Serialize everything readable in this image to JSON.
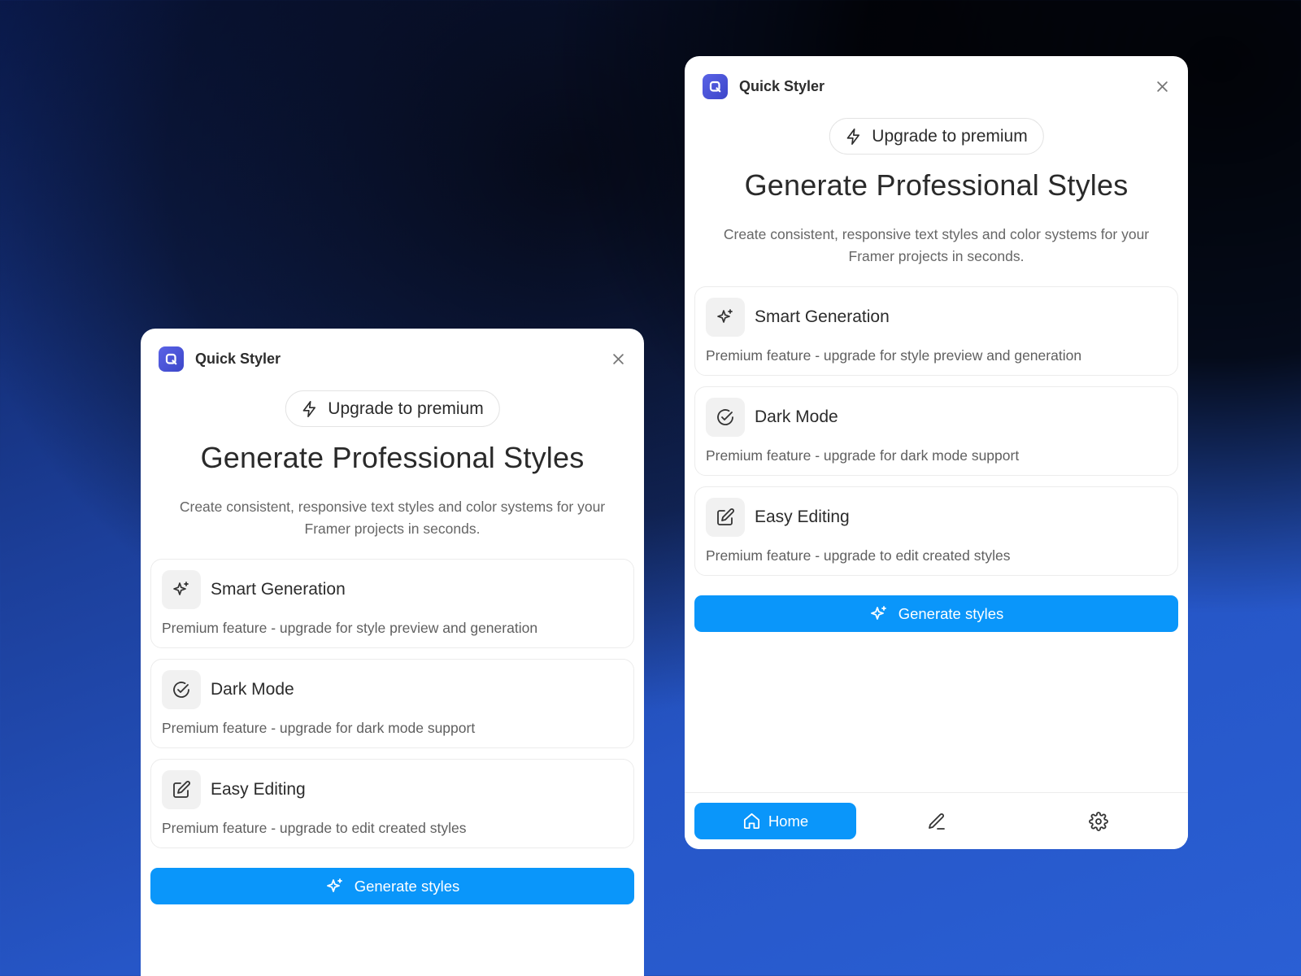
{
  "panels": [
    {
      "app_title": "Quick Styler",
      "upgrade_label": "Upgrade to premium",
      "headline": "Generate Professional Styles",
      "subhead_line1": "Create consistent, responsive text styles and color systems for your",
      "subhead_line2": "Framer projects in seconds.",
      "features": [
        {
          "icon": "sparkles-icon",
          "title": "Smart Generation",
          "description": "Premium feature - upgrade for style preview and generation"
        },
        {
          "icon": "check-circle-icon",
          "title": "Dark Mode",
          "description": "Premium feature - upgrade for dark mode support"
        },
        {
          "icon": "edit-square-icon",
          "title": "Easy Editing",
          "description": "Premium feature - upgrade to edit created styles"
        }
      ],
      "generate_label": "Generate styles"
    },
    {
      "app_title": "Quick Styler",
      "upgrade_label": "Upgrade to premium",
      "headline": "Generate Professional Styles",
      "subhead_line1": "Create consistent, responsive text styles and color systems for your",
      "subhead_line2": "Framer projects in seconds.",
      "features": [
        {
          "icon": "sparkles-icon",
          "title": "Smart Generation",
          "description": "Premium feature - upgrade for style preview and generation"
        },
        {
          "icon": "check-circle-icon",
          "title": "Dark Mode",
          "description": "Premium feature - upgrade for dark mode support"
        },
        {
          "icon": "edit-square-icon",
          "title": "Easy Editing",
          "description": "Premium feature - upgrade to edit created styles"
        }
      ],
      "generate_label": "Generate styles",
      "tabs": [
        {
          "icon": "home-icon",
          "label": "Home",
          "active": true
        },
        {
          "icon": "pen-icon",
          "label": "",
          "active": false
        },
        {
          "icon": "gear-icon",
          "label": "",
          "active": false
        }
      ]
    }
  ],
  "colors": {
    "accent": "#0a96fa",
    "logo": "#4a53d9",
    "text_primary": "#2a2a2a",
    "text_secondary": "#5f5f5f"
  }
}
